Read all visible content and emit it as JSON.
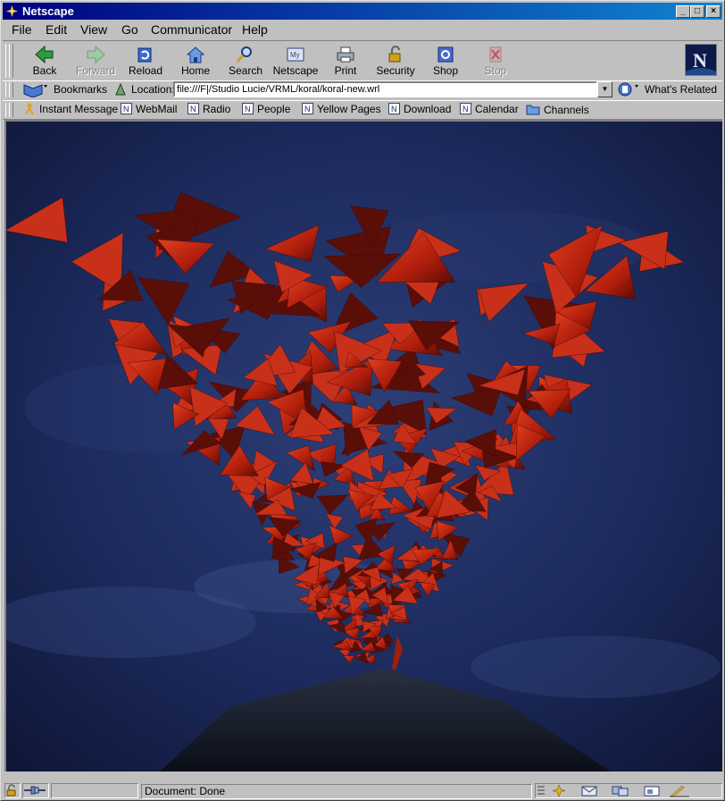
{
  "window": {
    "title": "Netscape"
  },
  "menu": {
    "file": "File",
    "edit": "Edit",
    "view": "View",
    "go": "Go",
    "communicator": "Communicator",
    "help": "Help"
  },
  "nav": {
    "back": "Back",
    "forward": "Forward",
    "reload": "Reload",
    "home": "Home",
    "search": "Search",
    "netscape": "Netscape",
    "print": "Print",
    "security": "Security",
    "shop": "Shop",
    "stop": "Stop"
  },
  "location": {
    "bookmarks": "Bookmarks",
    "label": "Location:",
    "url": "file:///F|/Studio Lucie/VRML/koral/koral-new.wrl",
    "whats_related": "What's Related"
  },
  "personal": {
    "instant_message": "Instant Message",
    "webmail": "WebMail",
    "radio": "Radio",
    "people": "People",
    "yellow_pages": "Yellow Pages",
    "download": "Download",
    "calendar": "Calendar",
    "channels": "Channels"
  },
  "status": {
    "text": "Document: Done"
  },
  "colors": {
    "title_start": "#000080",
    "title_end": "#1084d0",
    "chrome": "#c0c0c0",
    "coral": "#c42410",
    "sky": "#1b2a5e"
  }
}
